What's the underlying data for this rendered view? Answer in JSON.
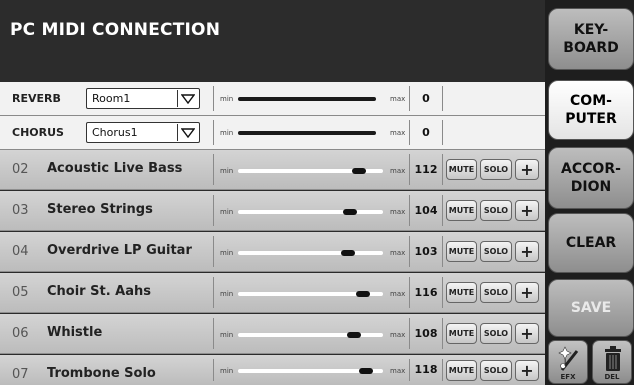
{
  "title": "PC MIDI CONNECTION",
  "effects": [
    {
      "label": "REVERB",
      "preset": "Room1",
      "min_label": "min",
      "max_label": "max",
      "value": "0",
      "level": 0.95
    },
    {
      "label": "CHORUS",
      "preset": "Chorus1",
      "min_label": "min",
      "max_label": "max",
      "value": "0",
      "level": 0.95
    }
  ],
  "tracks": [
    {
      "num": "02",
      "name": "Acoustic Live Bass",
      "min_label": "min",
      "max_label": "max",
      "value": "112",
      "level": 0.88,
      "mute": "MUTE",
      "solo": "SOLO",
      "add": "+"
    },
    {
      "num": "03",
      "name": "Stereo Strings",
      "min_label": "min",
      "max_label": "max",
      "value": "104",
      "level": 0.82,
      "mute": "MUTE",
      "solo": "SOLO",
      "add": "+"
    },
    {
      "num": "04",
      "name": "Overdrive LP Guitar",
      "min_label": "min",
      "max_label": "max",
      "value": "103",
      "level": 0.81,
      "mute": "MUTE",
      "solo": "SOLO",
      "add": "+"
    },
    {
      "num": "05",
      "name": "Choir St. Aahs",
      "min_label": "min",
      "max_label": "max",
      "value": "116",
      "level": 0.91,
      "mute": "MUTE",
      "solo": "SOLO",
      "add": "+"
    },
    {
      "num": "06",
      "name": "Whistle",
      "min_label": "min",
      "max_label": "max",
      "value": "108",
      "level": 0.85,
      "mute": "MUTE",
      "solo": "SOLO",
      "add": "+"
    },
    {
      "num": "07",
      "name": "Trombone Solo",
      "min_label": "min",
      "max_label": "max",
      "value": "118",
      "level": 0.93,
      "mute": "MUTE",
      "solo": "SOLO",
      "add": "+"
    }
  ],
  "sidebar": {
    "keyboard": "KEY-\nBOARD",
    "computer": "COM-\nPUTER",
    "accordion": "ACCOR-\nDION",
    "clear": "CLEAR",
    "save": "SAVE",
    "efx": "EFX",
    "del": "DEL",
    "efx_icon": "music-wand-icon",
    "del_icon": "trash-icon"
  },
  "colors": {
    "header_bg": "#2c2c2c",
    "active_button": "#ffffff",
    "track_bg": "#c8c8c8"
  }
}
